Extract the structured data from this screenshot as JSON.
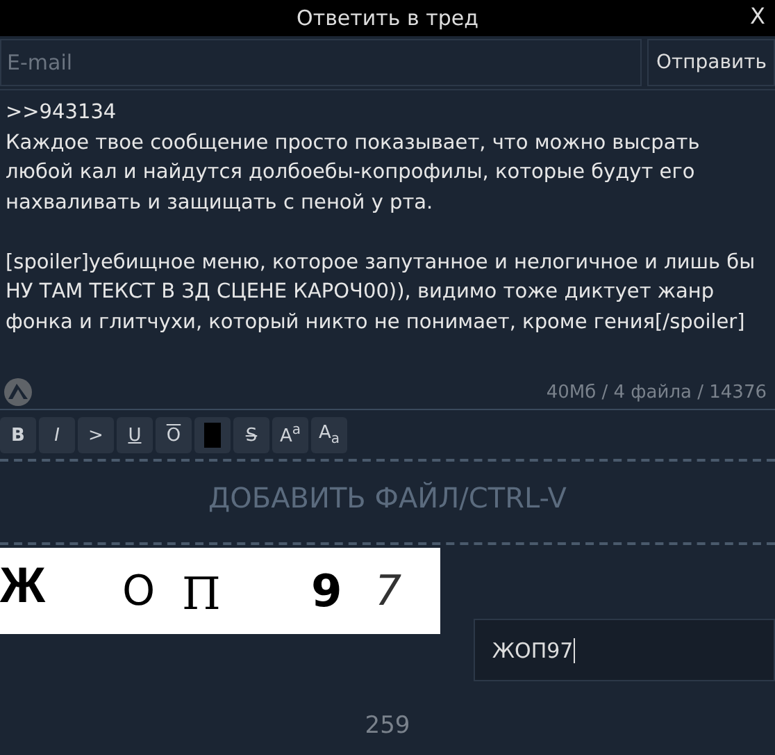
{
  "window": {
    "title": "Ответить в тред",
    "close": "X"
  },
  "email": {
    "placeholder": "E-mail"
  },
  "send_button": "Отправить",
  "message": {
    "paragraphs": [
      ">>943134\nКаждое твое сообщение просто показывает, что можно высрать любой кал и найдутся долбоебы-копрофилы, которые будут его нахваливать и защищать с пеной у рта.",
      "[spoiler]уебищное меню, которое запутанное и нелогичное и лишь бы НУ ТАМ ТЕКСТ В ЗД СЦЕНЕ КАРОЧ00)), видимо тоже диктует жанр фонка и глитчухи, который никто не понимает, кроме гения[/spoiler]"
    ]
  },
  "limits": "40Мб / 4 файла / 14376",
  "format_buttons": [
    {
      "kind": "bold",
      "label": "B"
    },
    {
      "kind": "italic",
      "label": "I"
    },
    {
      "kind": "quote",
      "label": ">"
    },
    {
      "kind": "underline",
      "label": "U"
    },
    {
      "kind": "overline",
      "label": "O"
    },
    {
      "kind": "spoiler"
    },
    {
      "kind": "strike",
      "label": "S"
    },
    {
      "kind": "sup",
      "label": "A",
      "sub": "a"
    },
    {
      "kind": "sub",
      "label": "A",
      "sub": "a"
    }
  ],
  "add_file": "ДОБАВИТЬ ФАЙЛ/CTRL-V",
  "captcha": {
    "characters": [
      "Ж",
      "О",
      "П",
      "9",
      "7"
    ]
  },
  "captcha_answer": {
    "value": "ЖОП97"
  },
  "counter": "259"
}
